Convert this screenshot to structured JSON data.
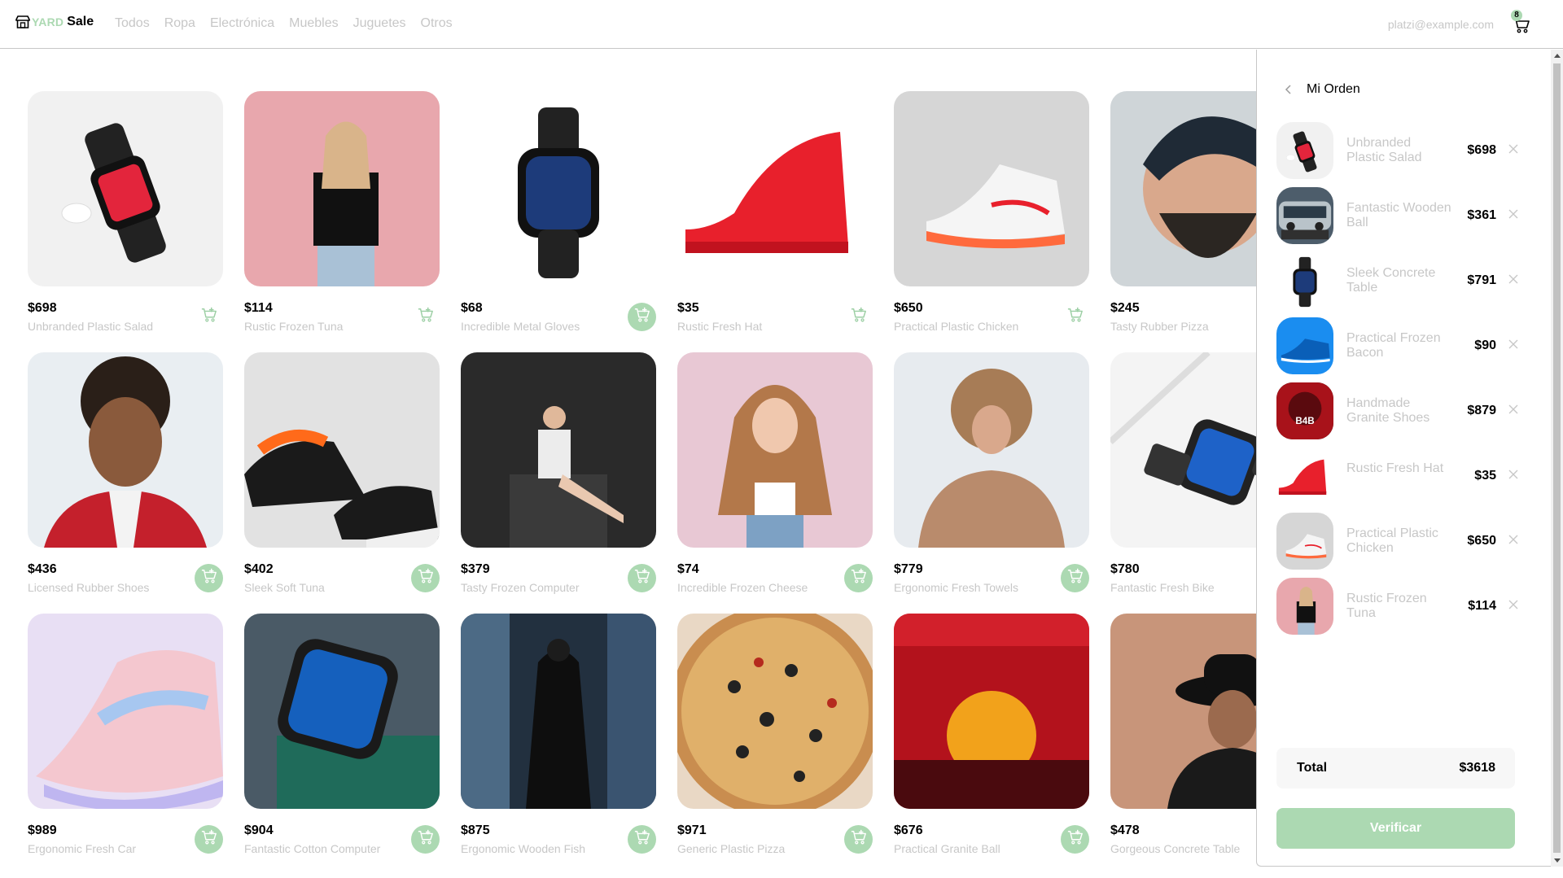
{
  "header": {
    "logo_yard": "YARD",
    "logo_sale": "Sale",
    "nav": [
      "Todos",
      "Ropa",
      "Electrónica",
      "Muebles",
      "Juguetes",
      "Otros"
    ],
    "email": "platzi@example.com",
    "cart_count": "8"
  },
  "products": [
    {
      "price": "$698",
      "name": "Unbranded Plastic Salad",
      "in_cart": true
    },
    {
      "price": "$114",
      "name": "Rustic Frozen Tuna",
      "in_cart": true
    },
    {
      "price": "$68",
      "name": "Incredible Metal Gloves",
      "in_cart": false
    },
    {
      "price": "$35",
      "name": "Rustic Fresh Hat",
      "in_cart": true
    },
    {
      "price": "$650",
      "name": "Practical Plastic Chicken",
      "in_cart": true
    },
    {
      "price": "$245",
      "name": "Tasty Rubber Pizza",
      "in_cart": false
    },
    {
      "price": "$436",
      "name": "Licensed Rubber Shoes",
      "in_cart": false
    },
    {
      "price": "$402",
      "name": "Sleek Soft Tuna",
      "in_cart": false
    },
    {
      "price": "$379",
      "name": "Tasty Frozen Computer",
      "in_cart": false
    },
    {
      "price": "$74",
      "name": "Incredible Frozen Cheese",
      "in_cart": false
    },
    {
      "price": "$779",
      "name": "Ergonomic Fresh Towels",
      "in_cart": false
    },
    {
      "price": "$780",
      "name": "Fantastic Fresh Bike",
      "in_cart": false
    },
    {
      "price": "$989",
      "name": "Ergonomic Fresh Car",
      "in_cart": false
    },
    {
      "price": "$904",
      "name": "Fantastic Cotton Computer",
      "in_cart": false
    },
    {
      "price": "$875",
      "name": "Ergonomic Wooden Fish",
      "in_cart": false
    },
    {
      "price": "$971",
      "name": "Generic Plastic Pizza",
      "in_cart": false
    },
    {
      "price": "$676",
      "name": "Practical Granite Ball",
      "in_cart": false
    },
    {
      "price": "$478",
      "name": "Gorgeous Concrete Table",
      "in_cart": false
    }
  ],
  "order": {
    "title": "Mi Orden",
    "items": [
      {
        "name": "Unbranded Plastic Salad",
        "price": "$698"
      },
      {
        "name": "Fantastic Wooden Ball",
        "price": "$361"
      },
      {
        "name": "Sleek Concrete Table",
        "price": "$791"
      },
      {
        "name": "Practical Frozen Bacon",
        "price": "$90"
      },
      {
        "name": "Handmade Granite Shoes",
        "price": "$879"
      },
      {
        "name": "Rustic Fresh Hat",
        "price": "$35"
      },
      {
        "name": "Practical Plastic Chicken",
        "price": "$650"
      },
      {
        "name": "Rustic Frozen Tuna",
        "price": "$114"
      }
    ],
    "total_label": "Total",
    "total_value": "$3618",
    "checkout_label": "Verificar"
  },
  "colors": {
    "accent": "#acd9b2",
    "muted_text": "#c7c7c7",
    "text": "#000000",
    "total_bg": "#f7f7f7"
  }
}
